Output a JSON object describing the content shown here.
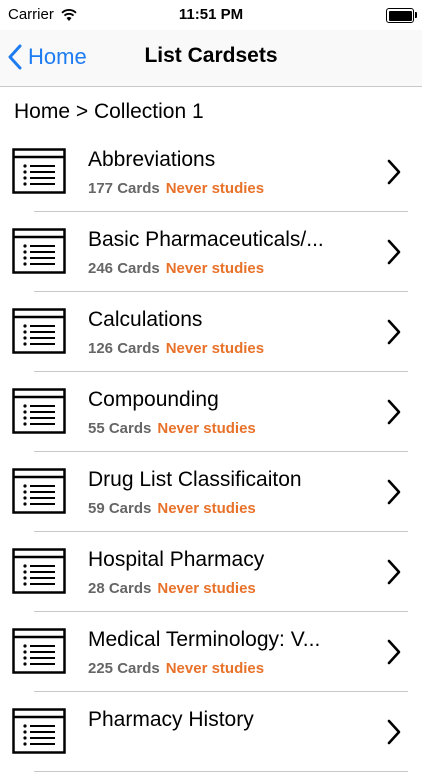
{
  "status_bar": {
    "carrier": "Carrier",
    "time": "11:51 PM"
  },
  "nav": {
    "back_label": "Home",
    "title": "List Cardsets"
  },
  "breadcrumb": "Home > Collection 1",
  "cardsets": [
    {
      "title": "Abbreviations",
      "count": "177 Cards",
      "status": "Never studies"
    },
    {
      "title": "Basic Pharmaceuticals/...",
      "count": "246 Cards",
      "status": "Never studies"
    },
    {
      "title": "Calculations",
      "count": "126 Cards",
      "status": "Never studies"
    },
    {
      "title": "Compounding",
      "count": "55 Cards",
      "status": "Never studies"
    },
    {
      "title": "Drug List Classificaiton",
      "count": "59 Cards",
      "status": "Never studies"
    },
    {
      "title": "Hospital Pharmacy",
      "count": "28 Cards",
      "status": "Never studies"
    },
    {
      "title": "Medical Terminology: V...",
      "count": "225 Cards",
      "status": "Never studies"
    },
    {
      "title": "Pharmacy History",
      "count": "",
      "status": ""
    }
  ],
  "colors": {
    "accent": "#1e7cf2",
    "status": "#e8722a",
    "meta": "#666666"
  },
  "icons": {
    "wifi": "wifi-icon",
    "battery": "battery-icon",
    "back": "chevron-left-icon",
    "row": "list-document-icon",
    "disclosure": "chevron-right-icon"
  }
}
